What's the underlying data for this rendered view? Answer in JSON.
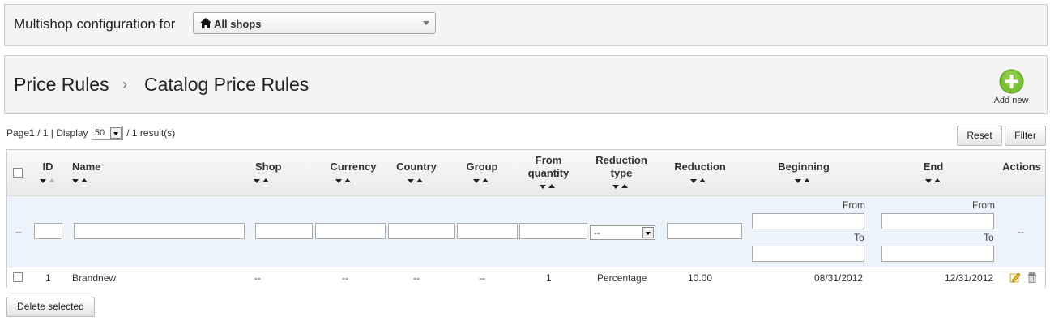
{
  "shop_bar": {
    "label": "Multishop configuration for",
    "selected": "All shops"
  },
  "breadcrumb": {
    "parent": "Price Rules",
    "separator": "›",
    "current": "Catalog Price Rules"
  },
  "add_new": {
    "label": "Add new"
  },
  "pagination": {
    "page_label": "Page",
    "page": "1",
    "total_pages": "/ 1",
    "display_label": "| Display",
    "per_page": "50",
    "results": "/ 1 result(s)"
  },
  "toolbar": {
    "reset_label": "Reset",
    "filter_label": "Filter",
    "delete_label": "Delete selected"
  },
  "columns": [
    "ID",
    "Name",
    "Shop",
    "Currency",
    "Country",
    "Group",
    "From quantity",
    "Reduction type",
    "Reduction",
    "Beginning",
    "End",
    "Actions"
  ],
  "column_lines": {
    "from_quantity": [
      "From",
      "quantity"
    ],
    "reduction_type": [
      "Reduction",
      "type"
    ]
  },
  "filters": {
    "placeholder_dash": "--",
    "reduction_type_value": "--",
    "from_label": "From",
    "to_label": "To",
    "actions_dash": "--"
  },
  "rows": [
    {
      "id": "1",
      "name": "Brandnew",
      "shop": "--",
      "currency": "--",
      "country": "--",
      "group": "--",
      "from_quantity": "1",
      "reduction_type": "Percentage",
      "reduction": "10.00",
      "beginning": "08/31/2012",
      "end": "12/31/2012"
    }
  ],
  "colors": {
    "add_button_green": "#7ac034",
    "header_bg": "#f4f4f4",
    "filter_row_bg": "#ecf3fb"
  }
}
